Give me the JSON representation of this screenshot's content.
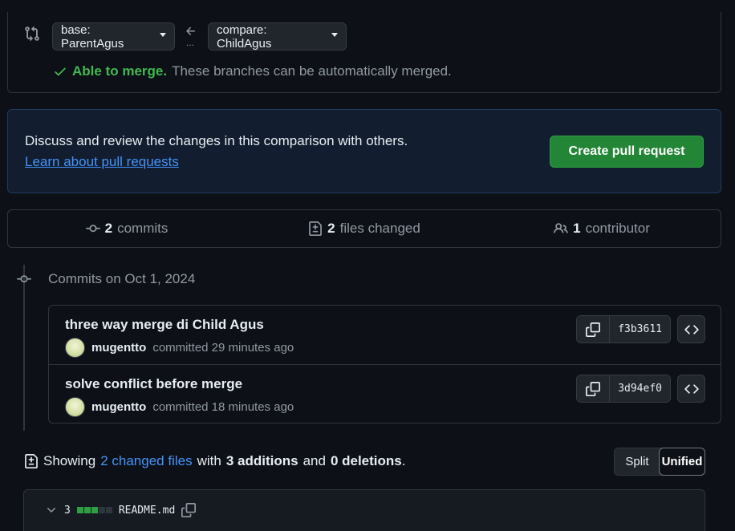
{
  "range": {
    "base_label": "base: ParentAgus",
    "compare_label": "compare: ChildAgus",
    "dots": "...",
    "merge_status": "Able to merge.",
    "merge_message": "These branches can be automatically merged."
  },
  "discuss": {
    "text": "Discuss and review the changes in this comparison with others.",
    "link": "Learn about pull requests",
    "button": "Create pull request"
  },
  "stats": {
    "commits_count": "2",
    "commits_label": "commits",
    "files_count": "2",
    "files_label": "files changed",
    "contributors_count": "1",
    "contributors_label": "contributor"
  },
  "timeline": {
    "date_heading": "Commits on Oct 1, 2024",
    "commits": [
      {
        "title": "three way merge di Child Agus",
        "author": "mugentto",
        "action": "committed 29 minutes ago",
        "sha": "f3b3611"
      },
      {
        "title": "solve conflict before merge",
        "author": "mugentto",
        "action": "committed 18 minutes ago",
        "sha": "3d94ef0"
      }
    ]
  },
  "summary": {
    "showing": "Showing",
    "changed_files": "2 changed files",
    "with": "with",
    "additions": "3 additions",
    "and": "and",
    "deletions": "0 deletions",
    "period": "."
  },
  "view_toggle": {
    "split": "Split",
    "unified": "Unified",
    "selected": "Unified"
  },
  "file": {
    "changes": "3",
    "name": "README.md",
    "diffstat": [
      "added",
      "added",
      "added",
      "neutral",
      "neutral"
    ]
  },
  "colors": {
    "accent_green": "#238636",
    "success_text": "#3fb950",
    "link_blue": "#4493f8",
    "background": "#0d1117"
  }
}
